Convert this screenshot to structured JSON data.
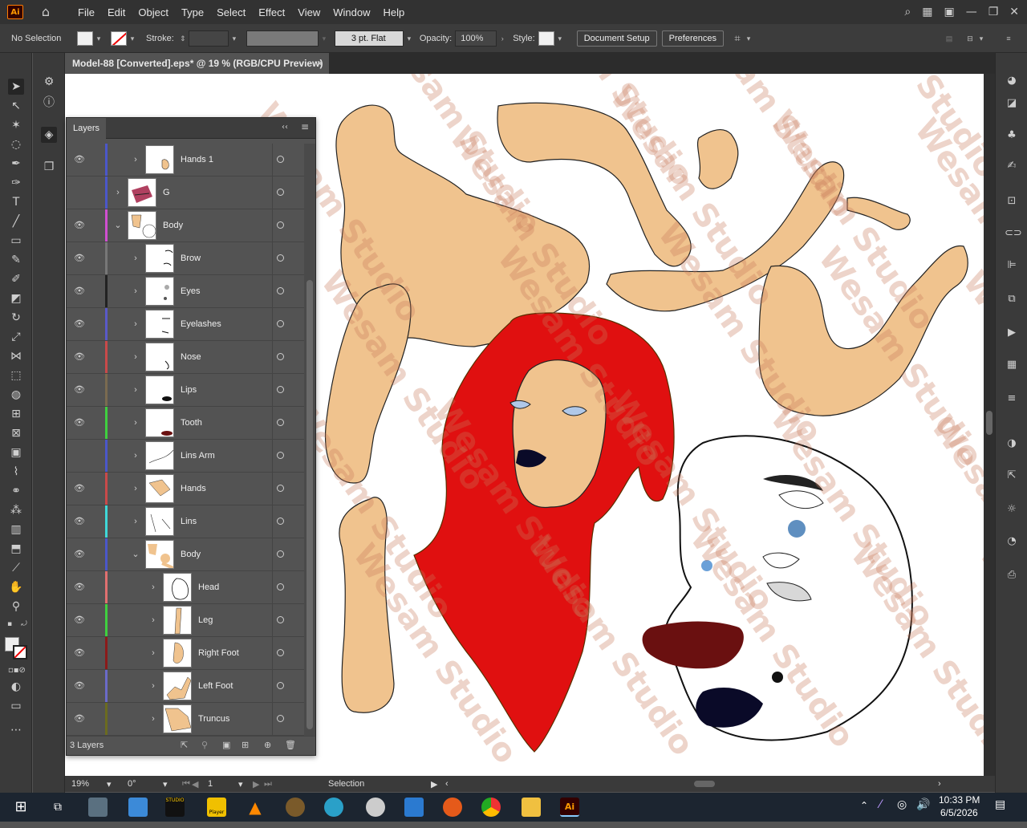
{
  "app": {
    "logo": "Ai"
  },
  "menubar": {
    "items": [
      "File",
      "Edit",
      "Object",
      "Type",
      "Select",
      "Effect",
      "View",
      "Window",
      "Help"
    ]
  },
  "controlbar": {
    "selection": "No Selection",
    "stroke_label": "Stroke:",
    "brush": "3 pt. Flat",
    "opacity_label": "Opacity:",
    "opacity_value": "100%",
    "style_label": "Style:",
    "document_setup": "Document Setup",
    "preferences": "Preferences"
  },
  "document": {
    "tab_title": "Model-88 [Converted].eps* @ 19 % (RGB/CPU Preview)",
    "close_icon": "×"
  },
  "layers_panel": {
    "title": "Layers",
    "rows": [
      {
        "name": "Hands 1",
        "visible": true,
        "color": "#4b57c9",
        "expanded": false,
        "indent": 0,
        "thumb": "hands1"
      },
      {
        "name": "G",
        "visible": false,
        "color": "#4b57c9",
        "expanded": false,
        "indent": -1,
        "thumb": "g"
      },
      {
        "name": "Body",
        "visible": true,
        "color": "#d04fd0",
        "expanded": true,
        "indent": -1,
        "thumb": "body"
      },
      {
        "name": "Brow",
        "visible": true,
        "color": "#777777",
        "expanded": false,
        "indent": 0,
        "thumb": "brow"
      },
      {
        "name": "Eyes",
        "visible": true,
        "color": "#222222",
        "expanded": false,
        "indent": 0,
        "thumb": "eyes"
      },
      {
        "name": "Eyelashes",
        "visible": true,
        "color": "#5a5ac8",
        "expanded": false,
        "indent": 0,
        "thumb": "eyelashes"
      },
      {
        "name": "Nose",
        "visible": true,
        "color": "#c94a4a",
        "expanded": false,
        "indent": 0,
        "thumb": "nose"
      },
      {
        "name": "Lips",
        "visible": true,
        "color": "#7a6a50",
        "expanded": false,
        "indent": 0,
        "thumb": "lips"
      },
      {
        "name": "Tooth",
        "visible": true,
        "color": "#3fcf3f",
        "expanded": false,
        "indent": 0,
        "thumb": "tooth"
      },
      {
        "name": "Lins Arm",
        "visible": false,
        "color": "#4b57c9",
        "expanded": false,
        "indent": 0,
        "thumb": "linsarm"
      },
      {
        "name": "Hands",
        "visible": true,
        "color": "#c94a4a",
        "expanded": false,
        "indent": 0,
        "thumb": "hands"
      },
      {
        "name": "Lins",
        "visible": true,
        "color": "#3fd8d8",
        "expanded": false,
        "indent": 0,
        "thumb": "lins"
      },
      {
        "name": "Body",
        "visible": true,
        "color": "#4b57c9",
        "expanded": true,
        "indent": 0,
        "thumb": "body2"
      },
      {
        "name": "Head",
        "visible": true,
        "color": "#e07070",
        "expanded": false,
        "indent": 1,
        "thumb": "head"
      },
      {
        "name": "Leg",
        "visible": true,
        "color": "#3fcf3f",
        "expanded": false,
        "indent": 1,
        "thumb": "leg"
      },
      {
        "name": "Right Foot",
        "visible": true,
        "color": "#8b1a1a",
        "expanded": false,
        "indent": 1,
        "thumb": "rfoot"
      },
      {
        "name": "Left Foot",
        "visible": true,
        "color": "#6a6ac8",
        "expanded": false,
        "indent": 1,
        "thumb": "lfoot"
      },
      {
        "name": "Truncus",
        "visible": true,
        "color": "#6b6b20",
        "expanded": false,
        "indent": 1,
        "thumb": "truncus"
      }
    ],
    "footer_count": "3 Layers"
  },
  "statusbar": {
    "zoom": "19%",
    "rotation": "0°",
    "artboard": "1",
    "tool": "Selection"
  },
  "canvas": {
    "watermark_text": "Wesam Studio",
    "skin_color": "#f0c38e",
    "hair_color": "#e01010"
  },
  "taskbar": {
    "time": "10:33 PM",
    "date": "6/5/2026",
    "player_label": "Player",
    "studio_label": "STUDIO"
  }
}
